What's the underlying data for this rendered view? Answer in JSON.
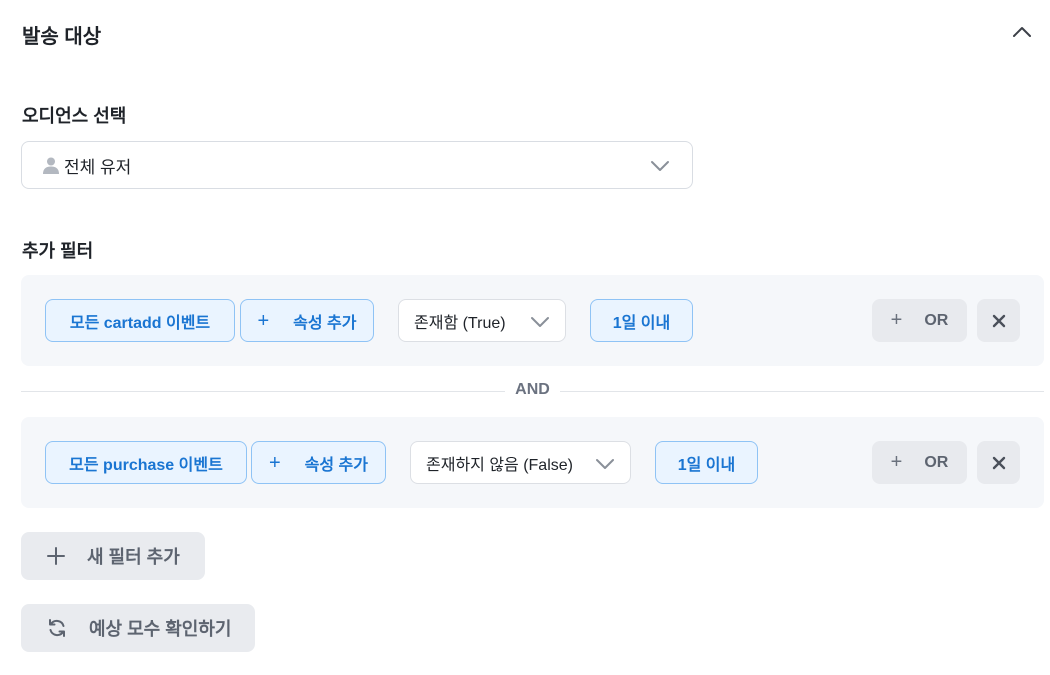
{
  "section": {
    "title": "발송 대상"
  },
  "audience": {
    "label": "오디언스 선택",
    "selected": "전체 유저"
  },
  "filters": {
    "label": "추가 필터",
    "items": [
      {
        "event": "모든 cartadd 이벤트",
        "add_property": "속성 추가",
        "condition": "존재함 (True)",
        "period": "1일 이내",
        "or_label": "OR"
      },
      {
        "event": "모든 purchase 이벤트",
        "add_property": "속성 추가",
        "condition": "존재하지 않음 (False)",
        "period": "1일 이내",
        "or_label": "OR"
      }
    ],
    "joiner": "AND"
  },
  "actions": {
    "add_filter": "새 필터 추가",
    "estimate": "예상 모수 확인하기"
  },
  "colors": {
    "accent": "#1a75d2",
    "chip_bg": "#eaf4ff",
    "filter_bg": "#f5f7fa",
    "button_gray": "#e9ebef"
  },
  "icons": [
    "chevron-up-icon",
    "user-icon",
    "chevron-down-icon",
    "plus-icon",
    "close-icon",
    "refresh-icon"
  ]
}
